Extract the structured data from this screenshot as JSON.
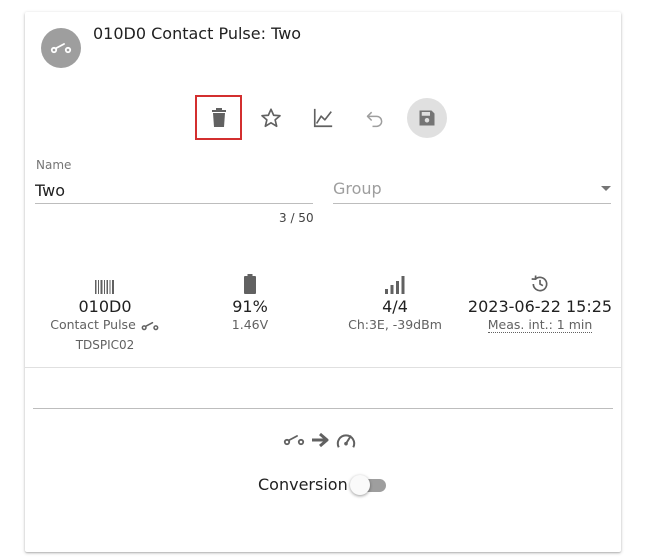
{
  "header": {
    "title": "010D0 Contact Pulse: Two",
    "avatar_icon": "contact-switch-icon"
  },
  "toolbar": {
    "buttons": [
      {
        "name": "delete",
        "icon": "trash-icon",
        "selected": true
      },
      {
        "name": "favorite",
        "icon": "star-outline-icon"
      },
      {
        "name": "chart",
        "icon": "line-chart-icon"
      },
      {
        "name": "undo",
        "icon": "undo-icon"
      },
      {
        "name": "save",
        "icon": "floppy-disk-icon"
      }
    ],
    "selected_outline_color": "#d32f2f"
  },
  "form": {
    "name_label": "Name",
    "name_value": "Two",
    "name_counter": "3 / 50",
    "group_placeholder": "Group"
  },
  "stats": {
    "device": {
      "id": "010D0",
      "type": "Contact Pulse",
      "model": "TDSPIC02",
      "icon": "barcode-icon"
    },
    "battery": {
      "percent": "91%",
      "voltage": "1.46V",
      "icon": "battery-icon"
    },
    "signal": {
      "value": "4/4",
      "detail": "Ch:3E, -39dBm",
      "icon": "signal-bars-icon"
    },
    "last_seen": {
      "timestamp": "2023-06-22 15:25",
      "interval": "Meas. int.: 1 min",
      "icon": "history-icon"
    }
  },
  "conversion": {
    "label": "Conversion",
    "enabled": false,
    "icons": [
      "contact-switch-icon",
      "arrow-right-icon",
      "speedometer-icon"
    ]
  },
  "colors": {
    "icon_gray": "#616161",
    "avatar_bg": "#9e9e9e",
    "save_bg": "#e0e0e0"
  }
}
